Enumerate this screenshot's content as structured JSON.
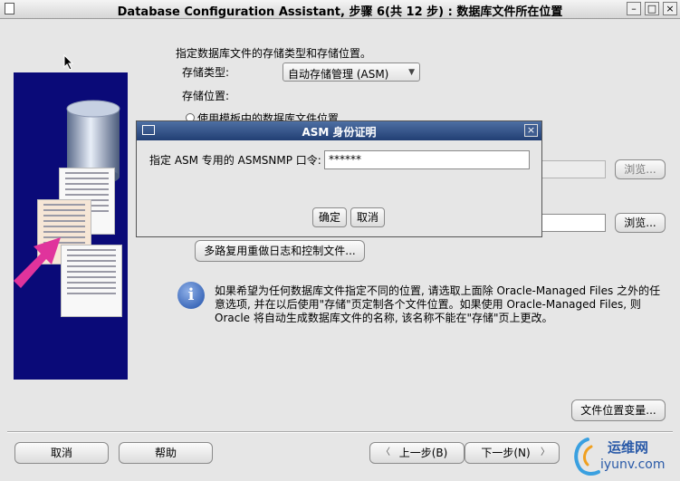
{
  "window": {
    "title": "Database Configuration Assistant, 步骤 6(共 12 步) : 数据库文件所在位置"
  },
  "main": {
    "instruction": "指定数据库文件的存储类型和存储位置。",
    "storage_type_label": "存储类型:",
    "storage_type_value": "自动存储管理 (ASM)",
    "storage_location_label": "存储位置:",
    "radio_template_label": "使用模板中的数据库文件位置",
    "browse_label_1": "浏览...",
    "browse_label_2": "浏览...",
    "multiplex_button": "多路复用重做日志和控制文件...",
    "info_text_1": "如果希望为任何数据库文件指定不同的位置, 请选取上面除 Oracle-Managed Files 之外的任",
    "info_text_2": "意选项, 并在以后使用\"存储\"页定制各个文件位置。如果使用 Oracle-Managed Files, 则",
    "info_text_3": "Oracle 将自动生成数据库文件的名称, 该名称不能在\"存储\"页上更改。",
    "file_location_vars_button": "文件位置变量..."
  },
  "footer": {
    "cancel": "取消",
    "help": "帮助",
    "back": "上一步(B)",
    "next": "下一步(N)"
  },
  "dialog": {
    "title": "ASM 身份证明",
    "prompt": "指定 ASM 专用的 ASMSNMP 口令:",
    "password_value": "******",
    "ok": "确定",
    "cancel": "取消"
  },
  "watermark": {
    "cn": "运维网",
    "url": "iyunv.com"
  }
}
